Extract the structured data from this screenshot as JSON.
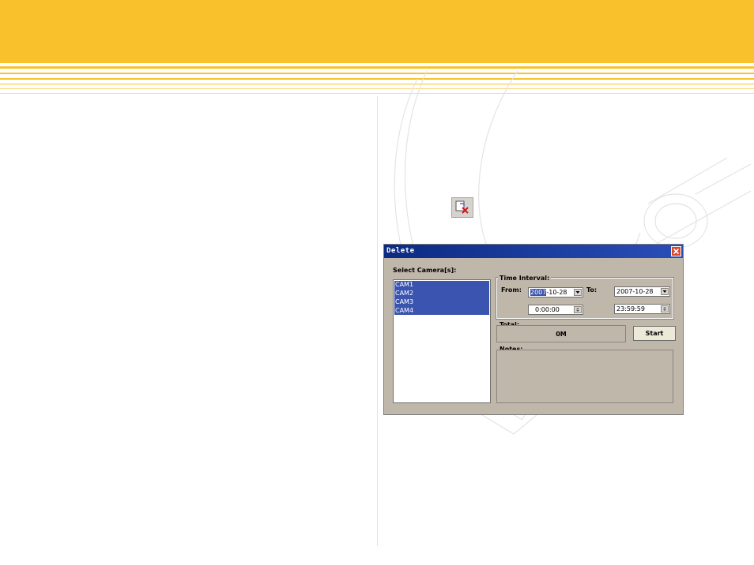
{
  "colors": {
    "banner": "#f9c12b",
    "dialog_bg": "#c0b7ab",
    "titlebar": "#0b2a82",
    "selection": "#3a54b0"
  },
  "toolbar": {
    "icon": "delete-record-icon"
  },
  "dialog": {
    "title": "Delete",
    "close_icon": "close-icon",
    "cameras_label": "Select Camera[s]:",
    "cameras": [
      "CAM1",
      "CAM2",
      "CAM3",
      "CAM4"
    ],
    "time_interval": {
      "title": "Time Interval:",
      "from_label": "From:",
      "to_label": "To:",
      "from_date_year": "2007",
      "from_date_rest": "-10-28",
      "to_date": "2007-10-28",
      "from_time": "0:00:00",
      "to_time": "23:59:59"
    },
    "total": {
      "title": "Total:",
      "value": "0M"
    },
    "start_label": "Start",
    "notes": {
      "title": "Notes:"
    }
  }
}
